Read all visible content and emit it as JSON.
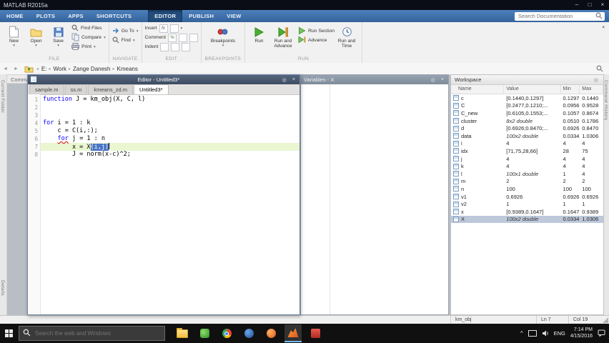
{
  "colors": {
    "ribbon_blue": "#3a6fad",
    "active_tab_blue": "#234d7c",
    "keyword_blue": "#0e00ff",
    "selection_blue": "#4a76c6",
    "current_line_green": "#e9f6d0",
    "run_green": "#4caf35",
    "matlab_orange": "#d9531e",
    "taskbar_black": "#101010"
  },
  "glyphs": {
    "dropdown": "▾",
    "back_arrow": "◄",
    "forward_arrow": "►",
    "collapse_ribbon": "▴",
    "crumb_separator": "▸",
    "minimize": "–",
    "maximize": "□",
    "close": "×",
    "undock": "◎",
    "tray_chevron": "^"
  },
  "titlebar": {
    "title": "MATLAB R2015a"
  },
  "ribbon": {
    "tabs": [
      {
        "label": "HOME",
        "active": false
      },
      {
        "label": "PLOTS",
        "active": false
      },
      {
        "label": "APPS",
        "active": false
      },
      {
        "label": "SHORTCUTS",
        "active": false
      },
      {
        "label": "EDITOR",
        "active": true
      },
      {
        "label": "PUBLISH",
        "active": false
      },
      {
        "label": "VIEW",
        "active": false
      }
    ],
    "search_placeholder": "Search Documentation",
    "file_section": {
      "label": "FILE",
      "big_buttons": [
        "New",
        "Open",
        "Save"
      ],
      "small_buttons": [
        "Find Files",
        "Compare",
        "Print"
      ]
    },
    "navigate_section": {
      "label": "NAVIGATE",
      "buttons": [
        "Go To",
        "Find"
      ]
    },
    "edit_section": {
      "label": "EDIT",
      "rows": [
        "Insert",
        "Comment",
        "Indent"
      ],
      "insert_fx": "fx",
      "comment_percent": "%"
    },
    "breakpoints_section": {
      "label": "BREAKPOINTS",
      "button": "Breakpoints"
    },
    "run_section": {
      "label": "RUN",
      "run": "Run",
      "run_and_advance": "Run and Advance",
      "run_section_btn": "Run Section",
      "advance": "Advance",
      "run_and_time": "Run and Time"
    }
  },
  "pathbar": {
    "segments": [
      "E:",
      "Work",
      "Zange Danesh",
      "Kmeans"
    ]
  },
  "minimized_panels": {
    "command_window": "Command Window",
    "current_folder": "Current Folder",
    "details": "Details",
    "command_history": "Command History"
  },
  "editor": {
    "title": "Editor - Untitled3*",
    "tabs": [
      {
        "label": "sample.m",
        "active": false
      },
      {
        "label": "ss.m",
        "active": false
      },
      {
        "label": "kmeans_zd.m",
        "active": false
      },
      {
        "label": "Untitled3*",
        "active": true
      }
    ],
    "lines": [
      {
        "num": 1,
        "tokens": [
          {
            "text": "function",
            "type": "kw"
          },
          {
            "text": " J = km_obj(X, C, l)",
            "type": "pl"
          }
        ]
      },
      {
        "num": 2,
        "tokens": []
      },
      {
        "num": 3,
        "tokens": []
      },
      {
        "num": 4,
        "tokens": [
          {
            "text": "for",
            "type": "kw"
          },
          {
            "text": " i = 1 : k",
            "type": "pl"
          }
        ]
      },
      {
        "num": 5,
        "tokens": [
          {
            "text": "    c = C(i,:);",
            "type": "pl"
          }
        ]
      },
      {
        "num": 6,
        "tokens": [
          {
            "text": "    ",
            "type": "pl"
          },
          {
            "text": "for",
            "type": "kw err"
          },
          {
            "text": " j = 1 : n",
            "type": "pl"
          }
        ]
      },
      {
        "num": 7,
        "current": true,
        "cursor": true,
        "tokens": [
          {
            "text": "        x = X",
            "type": "pl"
          },
          {
            "text": "(i,j)",
            "type": "sel"
          }
        ]
      },
      {
        "num": 8,
        "tokens": [
          {
            "text": "        J = norm(x-c)^2;",
            "type": "pl"
          }
        ]
      }
    ]
  },
  "variables_window": {
    "title": "Variables - X"
  },
  "workspace": {
    "title": "Workspace",
    "columns": [
      "Name",
      "Value",
      "Min",
      "Max"
    ],
    "rows": [
      {
        "name": "c",
        "value": "[0.1440,0.1297]",
        "min": "0.1297",
        "max": "0.1440"
      },
      {
        "name": "C",
        "value": "[0.2477,0.1210;...",
        "min": "0.0956",
        "max": "0.9528"
      },
      {
        "name": "C_new",
        "value": "[0.6105,0.1553;...",
        "min": "0.1057",
        "max": "0.8674"
      },
      {
        "name": "cluster",
        "value": "8x2 double",
        "dim": true,
        "min": "0.0510",
        "max": "0.1786"
      },
      {
        "name": "d",
        "value": "[0.6926;0.8470;...",
        "min": "0.6926",
        "max": "0.8470"
      },
      {
        "name": "data",
        "value": "100x2 double",
        "dim": true,
        "min": "0.0334",
        "max": "1.0306"
      },
      {
        "name": "i",
        "value": "4",
        "min": "4",
        "max": "4"
      },
      {
        "name": "idx",
        "value": "[71,75,28,66]",
        "min": "28",
        "max": "75"
      },
      {
        "name": "j",
        "value": "4",
        "min": "4",
        "max": "4"
      },
      {
        "name": "k",
        "value": "4",
        "min": "4",
        "max": "4"
      },
      {
        "name": "l",
        "value": "100x1 double",
        "dim": true,
        "min": "1",
        "max": "4"
      },
      {
        "name": "m",
        "value": "2",
        "min": "2",
        "max": "2"
      },
      {
        "name": "n",
        "value": "100",
        "min": "100",
        "max": "100"
      },
      {
        "name": "v1",
        "value": "0.6926",
        "min": "0.6926",
        "max": "0.6926"
      },
      {
        "name": "v2",
        "value": "1",
        "min": "1",
        "max": "1"
      },
      {
        "name": "x",
        "value": "[0.9389,0.1647]",
        "min": "0.1647",
        "max": "0.9389"
      },
      {
        "name": "X",
        "value": "100x2 double",
        "dim": true,
        "min": "0.0334",
        "max": "1.0306",
        "selected": true
      }
    ]
  },
  "statusbar": {
    "function_name": "km_obj",
    "line": "Ln 7",
    "col": "Col 19"
  },
  "taskbar": {
    "search_placeholder": "Search the web and Windows",
    "icons": [
      {
        "name": "file-explorer"
      },
      {
        "name": "app-green"
      },
      {
        "name": "chrome"
      },
      {
        "name": "app-blue"
      },
      {
        "name": "app-orange"
      },
      {
        "name": "matlab",
        "active": true
      },
      {
        "name": "app-red"
      }
    ],
    "tray": {
      "lang": "ENG",
      "time": "7:14 PM",
      "date": "4/15/2016"
    }
  }
}
